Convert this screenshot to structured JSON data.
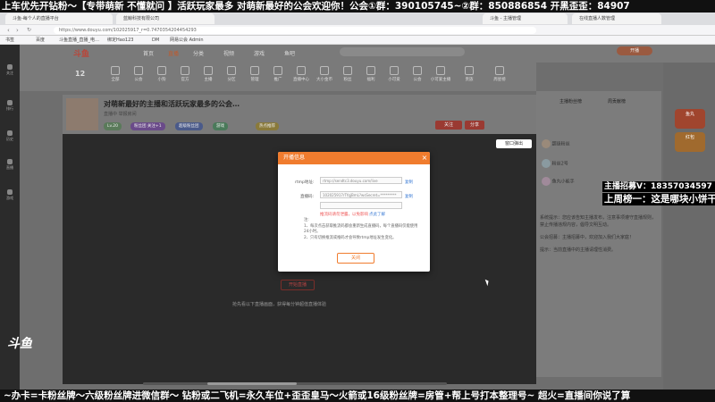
{
  "marquee_top": "上车优先开钻粉～【专带萌新 不懂就问 】活跃玩家最多 对萌新最好的公会欢迎你！公会①群：390105745~②群：850886854  开黑歪歪：84907",
  "browser": {
    "tabs": [
      "斗鱼-每个人的直播平台",
      "蓝鲸科技有限公司",
      "斗鱼 - 主播管理",
      "在线直播人数管理"
    ],
    "url": "https://www.douyu.com/102025917_r=0.7470354204454293",
    "bookmarks": [
      "书签",
      "百度",
      "斗鱼直播_直播_电…",
      "绑定Hao123",
      "DM",
      "网易公会 Admin"
    ]
  },
  "site": {
    "logo": "斗鱼",
    "nav": [
      "首页",
      "直播",
      "分类",
      "视频",
      "游戏",
      "鱼吧"
    ],
    "active_nav": "直播",
    "header_button": "开播",
    "rank_number": "12",
    "categories": [
      "全部",
      "公会",
      "小狗",
      "官方",
      "主播",
      "分区",
      "管理",
      "推广",
      "直播中心",
      "大小金币",
      "粉丝",
      "福利",
      "小可爱",
      "公会",
      "小可爱主播",
      "贵族",
      "周星榜"
    ],
    "left_nav": [
      "关注",
      "排行",
      "历史",
      "直播",
      "游戏"
    ]
  },
  "room": {
    "title": "对萌新最好的主播和活跃玩家最多的公会…",
    "subtitle": "直播中   举报房间",
    "anchor": "主播名",
    "badges": [
      "Lv.20",
      "粉丝团 关注+1",
      "超级粉丝团",
      "游戏",
      "热点推荐"
    ],
    "follow_label": "关注",
    "share_label": "分享"
  },
  "video": {
    "popout_label": "窗口弹出",
    "hint": "抢先看以下直播画面，获得每分钟超值直播体验",
    "button": "开始直播",
    "watermark": "斗鱼"
  },
  "modal": {
    "title": "开播信息",
    "close": "×",
    "rtmp_label": "rtmp地址:",
    "rtmp_value": "rtmp://sendtc3.douyu.com/live",
    "rtmp_copy": "复制",
    "code_label": "直播码:",
    "code_value": "102025917rTfqjBmL?wsSecret=*********",
    "code_copy": "复制",
    "select_value": "",
    "warn": "推流码请勿泄露，以免影响",
    "warn_link": "点此了解",
    "note_title": "注:",
    "notes": [
      "1、每次点击获取推流码都会重新生成直播码，每个直播码仅能使用24小时。",
      "2、只有切换推流或推码才会导致rtmp地址发生变化。"
    ],
    "confirm": "关闭"
  },
  "right_panel": {
    "tabs": [
      "主播粉丝榜",
      "周贡献榜"
    ],
    "rank_rows": [
      "超级粉丝",
      "粉丝2号",
      "鱼丸小能手"
    ],
    "chat": [
      "系统提示：您应该告知主播发布，注意事项遵守直播规则，禁止传播违规内容，倡导文明互动。",
      "公会招募：主播招募中，欢迎加入我们大家庭！",
      "提示：当前直播中的主播请理性消费。"
    ],
    "gift_labels": [
      "鱼丸",
      "红包"
    ]
  },
  "ads": {
    "line1": "主播招募V：18357034597",
    "line2": "上周榜一：这是哪块小饼干"
  },
  "marquee_bottom": "~办卡=卡粉丝牌～六级粉丝牌进微信群～ 钻粉或二飞机=永久车位+歪歪皇马～火箭或16级粉丝牌=房管+帮上号打本整理号~  超火=直播间你说了算"
}
